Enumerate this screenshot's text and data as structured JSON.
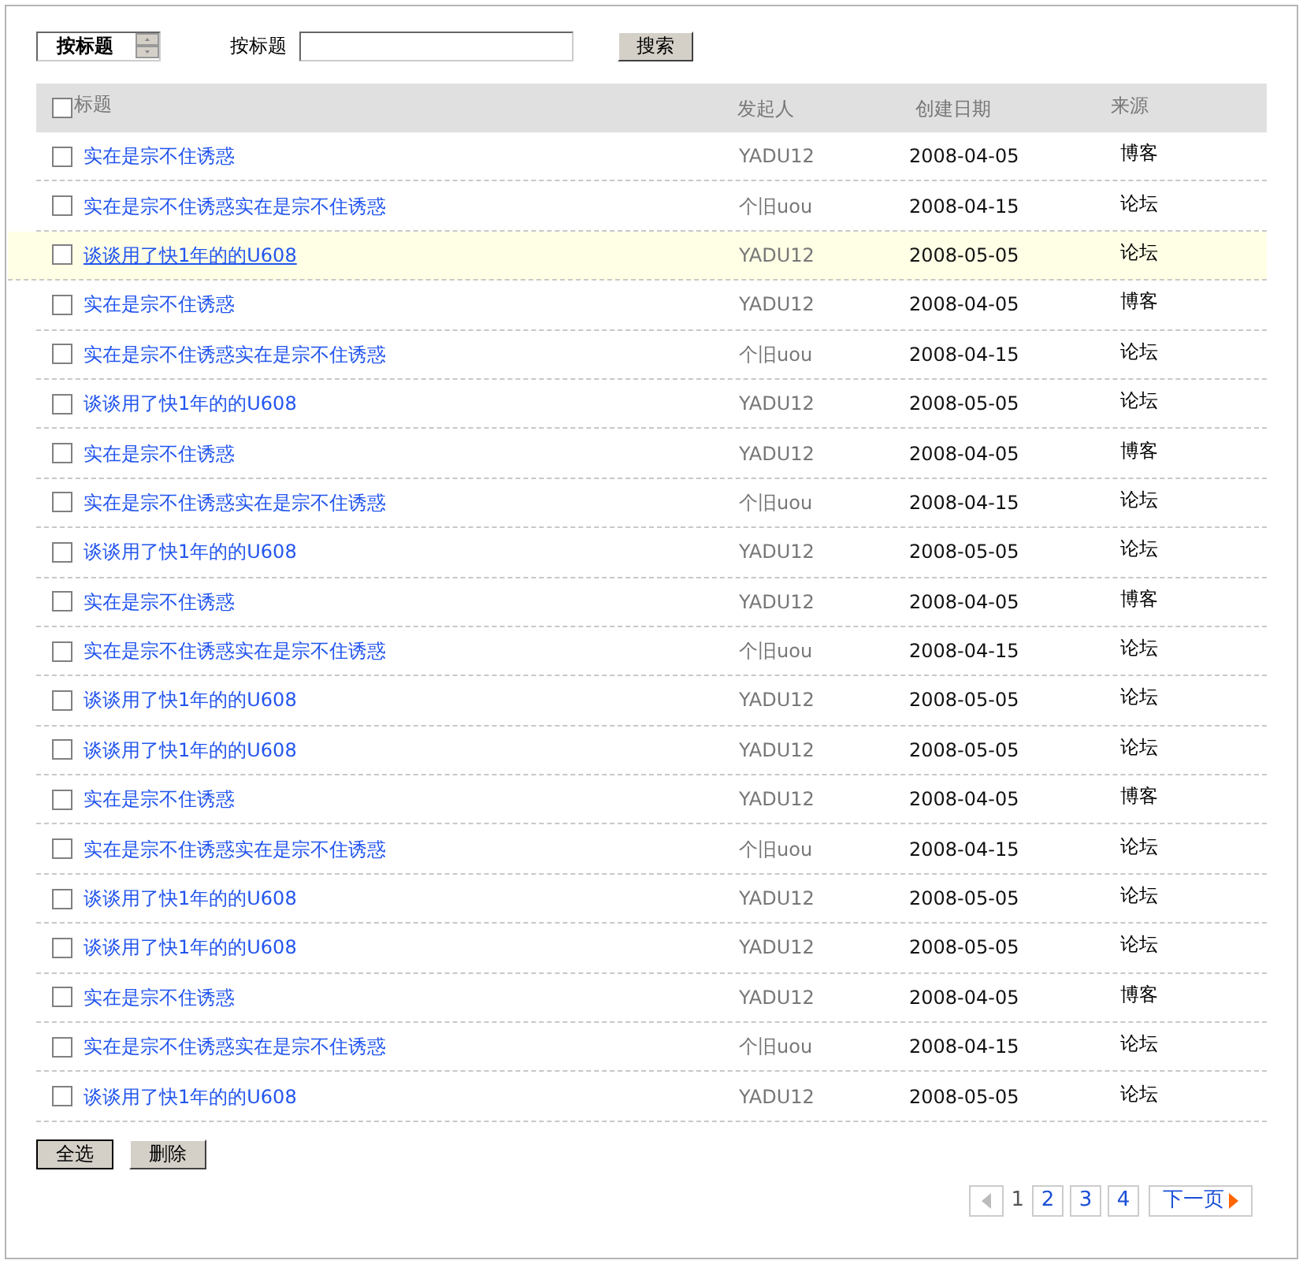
{
  "filter": {
    "select_value": "按标题",
    "label": "按标题",
    "search_button": "搜索"
  },
  "table": {
    "columns": [
      "标题",
      "发起人",
      "创建日期",
      "来源"
    ],
    "all_checked": false,
    "rows": [
      {
        "title": "实在是宗不住诱惑",
        "author": "YADU12",
        "date": "2008-04-05",
        "source": "博客",
        "checked": false,
        "highlighted": false
      },
      {
        "title": "实在是宗不住诱惑实在是宗不住诱惑",
        "author": "个旧uou",
        "date": "2008-04-15",
        "source": "论坛",
        "checked": false,
        "highlighted": false
      },
      {
        "title": "谈谈用了快1年的的U608",
        "author": "YADU12",
        "date": "2008-05-05",
        "source": "论坛",
        "checked": false,
        "highlighted": true
      },
      {
        "title": "实在是宗不住诱惑",
        "author": "YADU12",
        "date": "2008-04-05",
        "source": "博客",
        "checked": false,
        "highlighted": false
      },
      {
        "title": "实在是宗不住诱惑实在是宗不住诱惑",
        "author": "个旧uou",
        "date": "2008-04-15",
        "source": "论坛",
        "checked": false,
        "highlighted": false
      },
      {
        "title": "谈谈用了快1年的的U608",
        "author": "YADU12",
        "date": "2008-05-05",
        "source": "论坛",
        "checked": false,
        "highlighted": false
      },
      {
        "title": "实在是宗不住诱惑",
        "author": "YADU12",
        "date": "2008-04-05",
        "source": "博客",
        "checked": false,
        "highlighted": false
      },
      {
        "title": "实在是宗不住诱惑实在是宗不住诱惑",
        "author": "个旧uou",
        "date": "2008-04-15",
        "source": "论坛",
        "checked": false,
        "highlighted": false
      },
      {
        "title": "谈谈用了快1年的的U608",
        "author": "YADU12",
        "date": "2008-05-05",
        "source": "论坛",
        "checked": false,
        "highlighted": false
      },
      {
        "title": "实在是宗不住诱惑",
        "author": "YADU12",
        "date": "2008-04-05",
        "source": "博客",
        "checked": false,
        "highlighted": false
      },
      {
        "title": "实在是宗不住诱惑实在是宗不住诱惑",
        "author": "个旧uou",
        "date": "2008-04-15",
        "source": "论坛",
        "checked": false,
        "highlighted": false
      },
      {
        "title": "谈谈用了快1年的的U608",
        "author": "YADU12",
        "date": "2008-05-05",
        "source": "论坛",
        "checked": false,
        "highlighted": false
      },
      {
        "title": "谈谈用了快1年的的U608",
        "author": "YADU12",
        "date": "2008-05-05",
        "source": "论坛",
        "checked": false,
        "highlighted": false
      },
      {
        "title": "实在是宗不住诱惑",
        "author": "YADU12",
        "date": "2008-04-05",
        "source": "博客",
        "checked": false,
        "highlighted": false
      },
      {
        "title": "实在是宗不住诱惑实在是宗不住诱惑",
        "author": "个旧uou",
        "date": "2008-04-15",
        "source": "论坛",
        "checked": false,
        "highlighted": false
      },
      {
        "title": "谈谈用了快1年的的U608",
        "author": "YADU12",
        "date": "2008-05-05",
        "source": "论坛",
        "checked": false,
        "highlighted": false
      },
      {
        "title": "谈谈用了快1年的的U608",
        "author": "YADU12",
        "date": "2008-05-05",
        "source": "论坛",
        "checked": false,
        "highlighted": false
      },
      {
        "title": "实在是宗不住诱惑",
        "author": "YADU12",
        "date": "2008-04-05",
        "source": "博客",
        "checked": false,
        "highlighted": false
      },
      {
        "title": "实在是宗不住诱惑实在是宗不住诱惑",
        "author": "个旧uou",
        "date": "2008-04-15",
        "source": "论坛",
        "checked": false,
        "highlighted": false
      },
      {
        "title": "谈谈用了快1年的的U608",
        "author": "YADU12",
        "date": "2008-05-05",
        "source": "论坛",
        "checked": false,
        "highlighted": false
      }
    ]
  },
  "actions": [
    "全选",
    "删除"
  ],
  "pagination": {
    "prev_disabled": true,
    "pages": [
      {
        "label": "1",
        "selected": true
      },
      {
        "label": "2",
        "selected": false
      },
      {
        "label": "3",
        "selected": false
      },
      {
        "label": "4",
        "selected": false
      }
    ],
    "next": "下一页"
  }
}
